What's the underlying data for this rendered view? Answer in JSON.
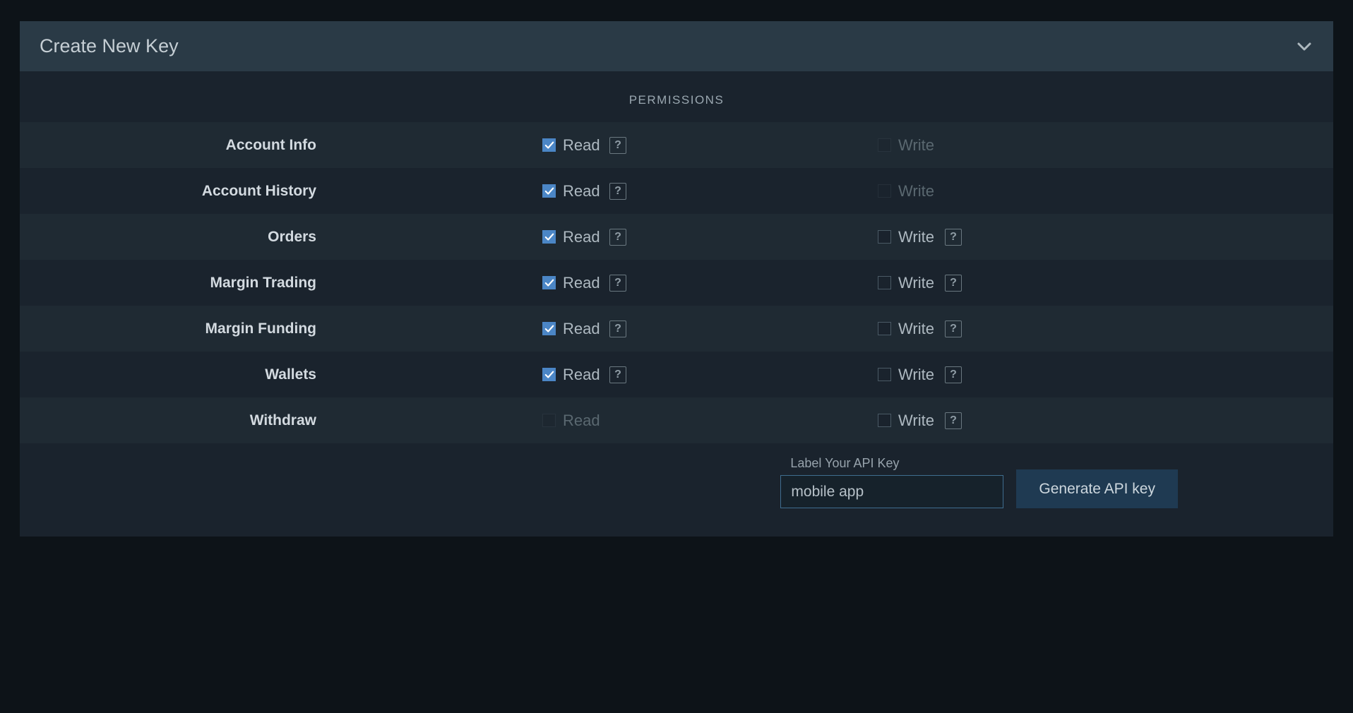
{
  "header": {
    "title": "Create New Key"
  },
  "permissions": {
    "header_label": "PERMISSIONS",
    "read_label": "Read",
    "write_label": "Write",
    "rows": [
      {
        "label": "Account Info",
        "read_checked": true,
        "read_enabled": true,
        "read_help": true,
        "write_checked": false,
        "write_enabled": false,
        "write_help": false
      },
      {
        "label": "Account History",
        "read_checked": true,
        "read_enabled": true,
        "read_help": true,
        "write_checked": false,
        "write_enabled": false,
        "write_help": false
      },
      {
        "label": "Orders",
        "read_checked": true,
        "read_enabled": true,
        "read_help": true,
        "write_checked": false,
        "write_enabled": true,
        "write_help": true
      },
      {
        "label": "Margin Trading",
        "read_checked": true,
        "read_enabled": true,
        "read_help": true,
        "write_checked": false,
        "write_enabled": true,
        "write_help": true
      },
      {
        "label": "Margin Funding",
        "read_checked": true,
        "read_enabled": true,
        "read_help": true,
        "write_checked": false,
        "write_enabled": true,
        "write_help": true
      },
      {
        "label": "Wallets",
        "read_checked": true,
        "read_enabled": true,
        "read_help": true,
        "write_checked": false,
        "write_enabled": true,
        "write_help": true
      },
      {
        "label": "Withdraw",
        "read_checked": false,
        "read_enabled": false,
        "read_help": false,
        "write_checked": false,
        "write_enabled": true,
        "write_help": true
      }
    ]
  },
  "footer": {
    "label_your_key": "Label Your API Key",
    "key_value": "mobile app",
    "generate_label": "Generate API key"
  },
  "help_glyph": "?"
}
